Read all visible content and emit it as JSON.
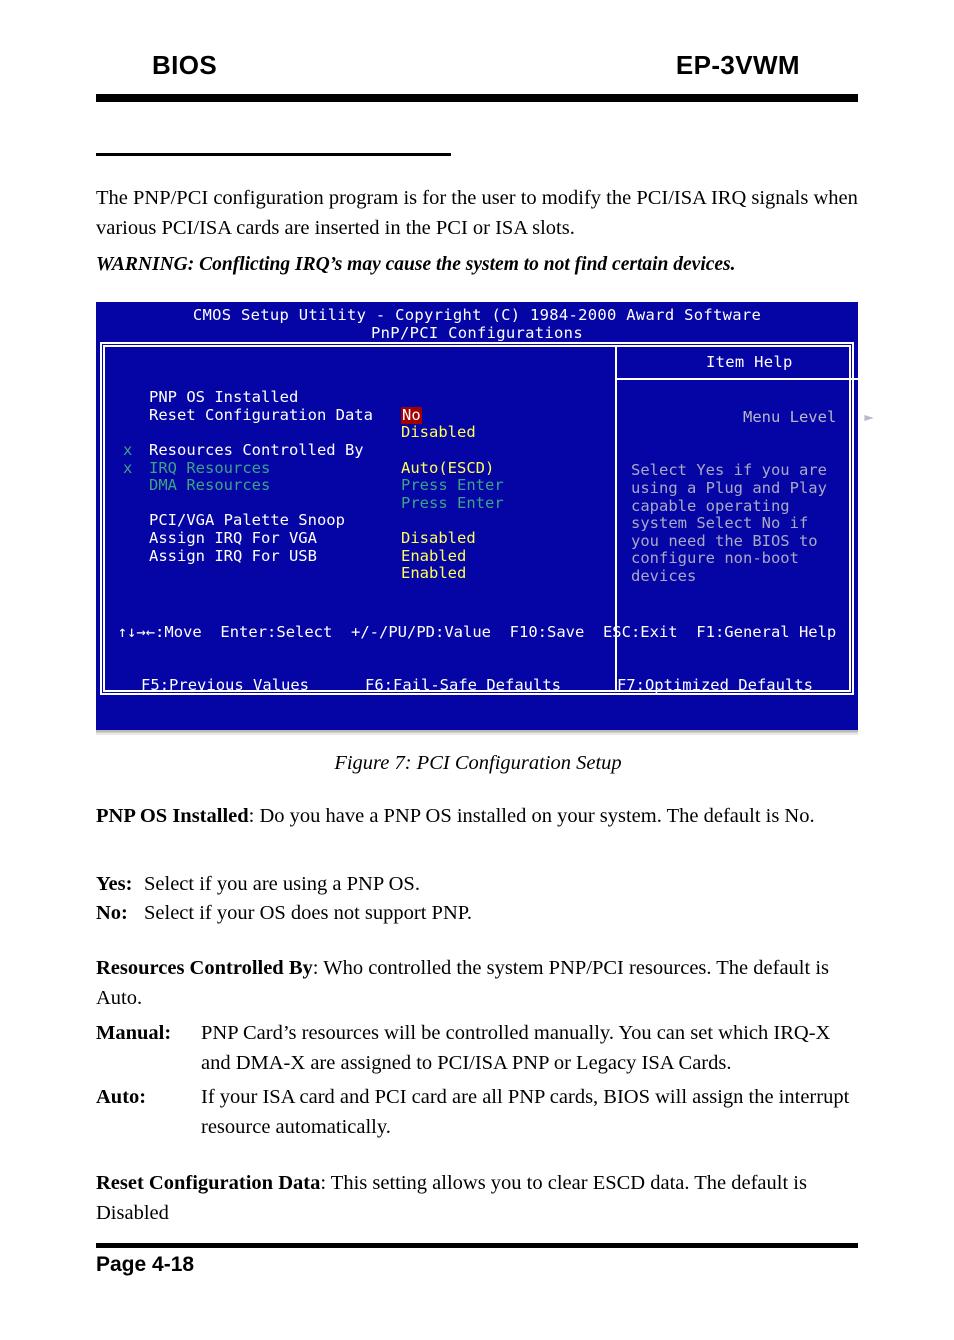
{
  "header": {
    "left": "BIOS",
    "right": "EP-3VWM"
  },
  "intro": "The PNP/PCI configuration program is for the user to modify the PCI/ISA IRQ signals when various PCI/ISA cards are inserted in the PCI or ISA slots.",
  "warning": "WARNING: Conflicting IRQ’s may cause the system to not find certain devices.",
  "figure_caption": "Figure 7:  PCI Configuration Setup",
  "bios": {
    "title_line1": "CMOS Setup Utility - Copyright (C) 1984-2000 Award Software",
    "title_line2": "PnP/PCI Configurations",
    "item_help_title": "Item Help",
    "menu_level_label": "Menu Level",
    "menu_level_arrow": "►",
    "help_text": "Select Yes if you are\nusing a Plug and Play\ncapable operating\nsystem Select No if\nyou need the BIOS to\nconfigure non-boot\ndevices",
    "options": [
      {
        "mark": "",
        "label": "PNP OS Installed",
        "value": "No",
        "selected": true,
        "dim": false
      },
      {
        "mark": "",
        "label": "Reset Configuration Data",
        "value": "Disabled",
        "selected": false,
        "dim": false
      },
      {
        "mark": "",
        "label": "Resources Controlled By",
        "value": "Auto(ESCD)",
        "selected": false,
        "dim": false
      },
      {
        "mark": "x",
        "label": "IRQ Resources",
        "value": "Press Enter",
        "selected": false,
        "dim": true
      },
      {
        "mark": "x",
        "label": "DMA Resources",
        "value": "Press Enter",
        "selected": false,
        "dim": true
      },
      {
        "mark": "",
        "label": "PCI/VGA Palette Snoop",
        "value": "Disabled",
        "selected": false,
        "dim": false
      },
      {
        "mark": "",
        "label": "Assign IRQ For VGA",
        "value": "Enabled",
        "selected": false,
        "dim": false
      },
      {
        "mark": "",
        "label": "Assign IRQ For USB",
        "value": "Enabled",
        "selected": false,
        "dim": false
      }
    ],
    "footer_line1": "↑↓→←:Move  Enter:Select  +/-/PU/PD:Value  F10:Save  ESC:Exit  F1:General Help",
    "footer_line2": "F5:Previous Values      F6:Fail-Safe Defaults      F7:Optimized Defaults",
    "colors": {
      "background": "#0505a5",
      "label": "#ffffff",
      "value": "#ffff55",
      "selected_background": "#a00000",
      "dimmed": "#3aa487",
      "help": "#a9a9c4"
    }
  },
  "descriptions": {
    "pnp_os_term": "PNP OS Installed",
    "pnp_os_text": ": Do you have a PNP OS installed on  your system. The default is No.",
    "yes_term": "Yes:",
    "yes_text": "Select if you are using a PNP OS.",
    "no_term": "No:",
    "no_text": "Select if your OS does not support PNP.",
    "resources_term": "Resources Controlled By",
    "resources_text": ":  Who controlled the system PNP/PCI resources. The default is Auto.",
    "manual_term": "Manual:",
    "manual_text": "PNP Card’s resources will be controlled manually. You can set which IRQ-X and DMA-X are assigned to PCI/ISA PNP or Legacy ISA Cards.",
    "auto_term": "Auto:",
    "auto_text": "If your ISA card and PCI card are all PNP cards, BIOS will assign the interrupt resource automatically.",
    "reset_term": "Reset Configuration Data",
    "reset_text": ": This setting allows you to clear ESCD data. The default is Disabled"
  },
  "page_number": "Page 4-18"
}
